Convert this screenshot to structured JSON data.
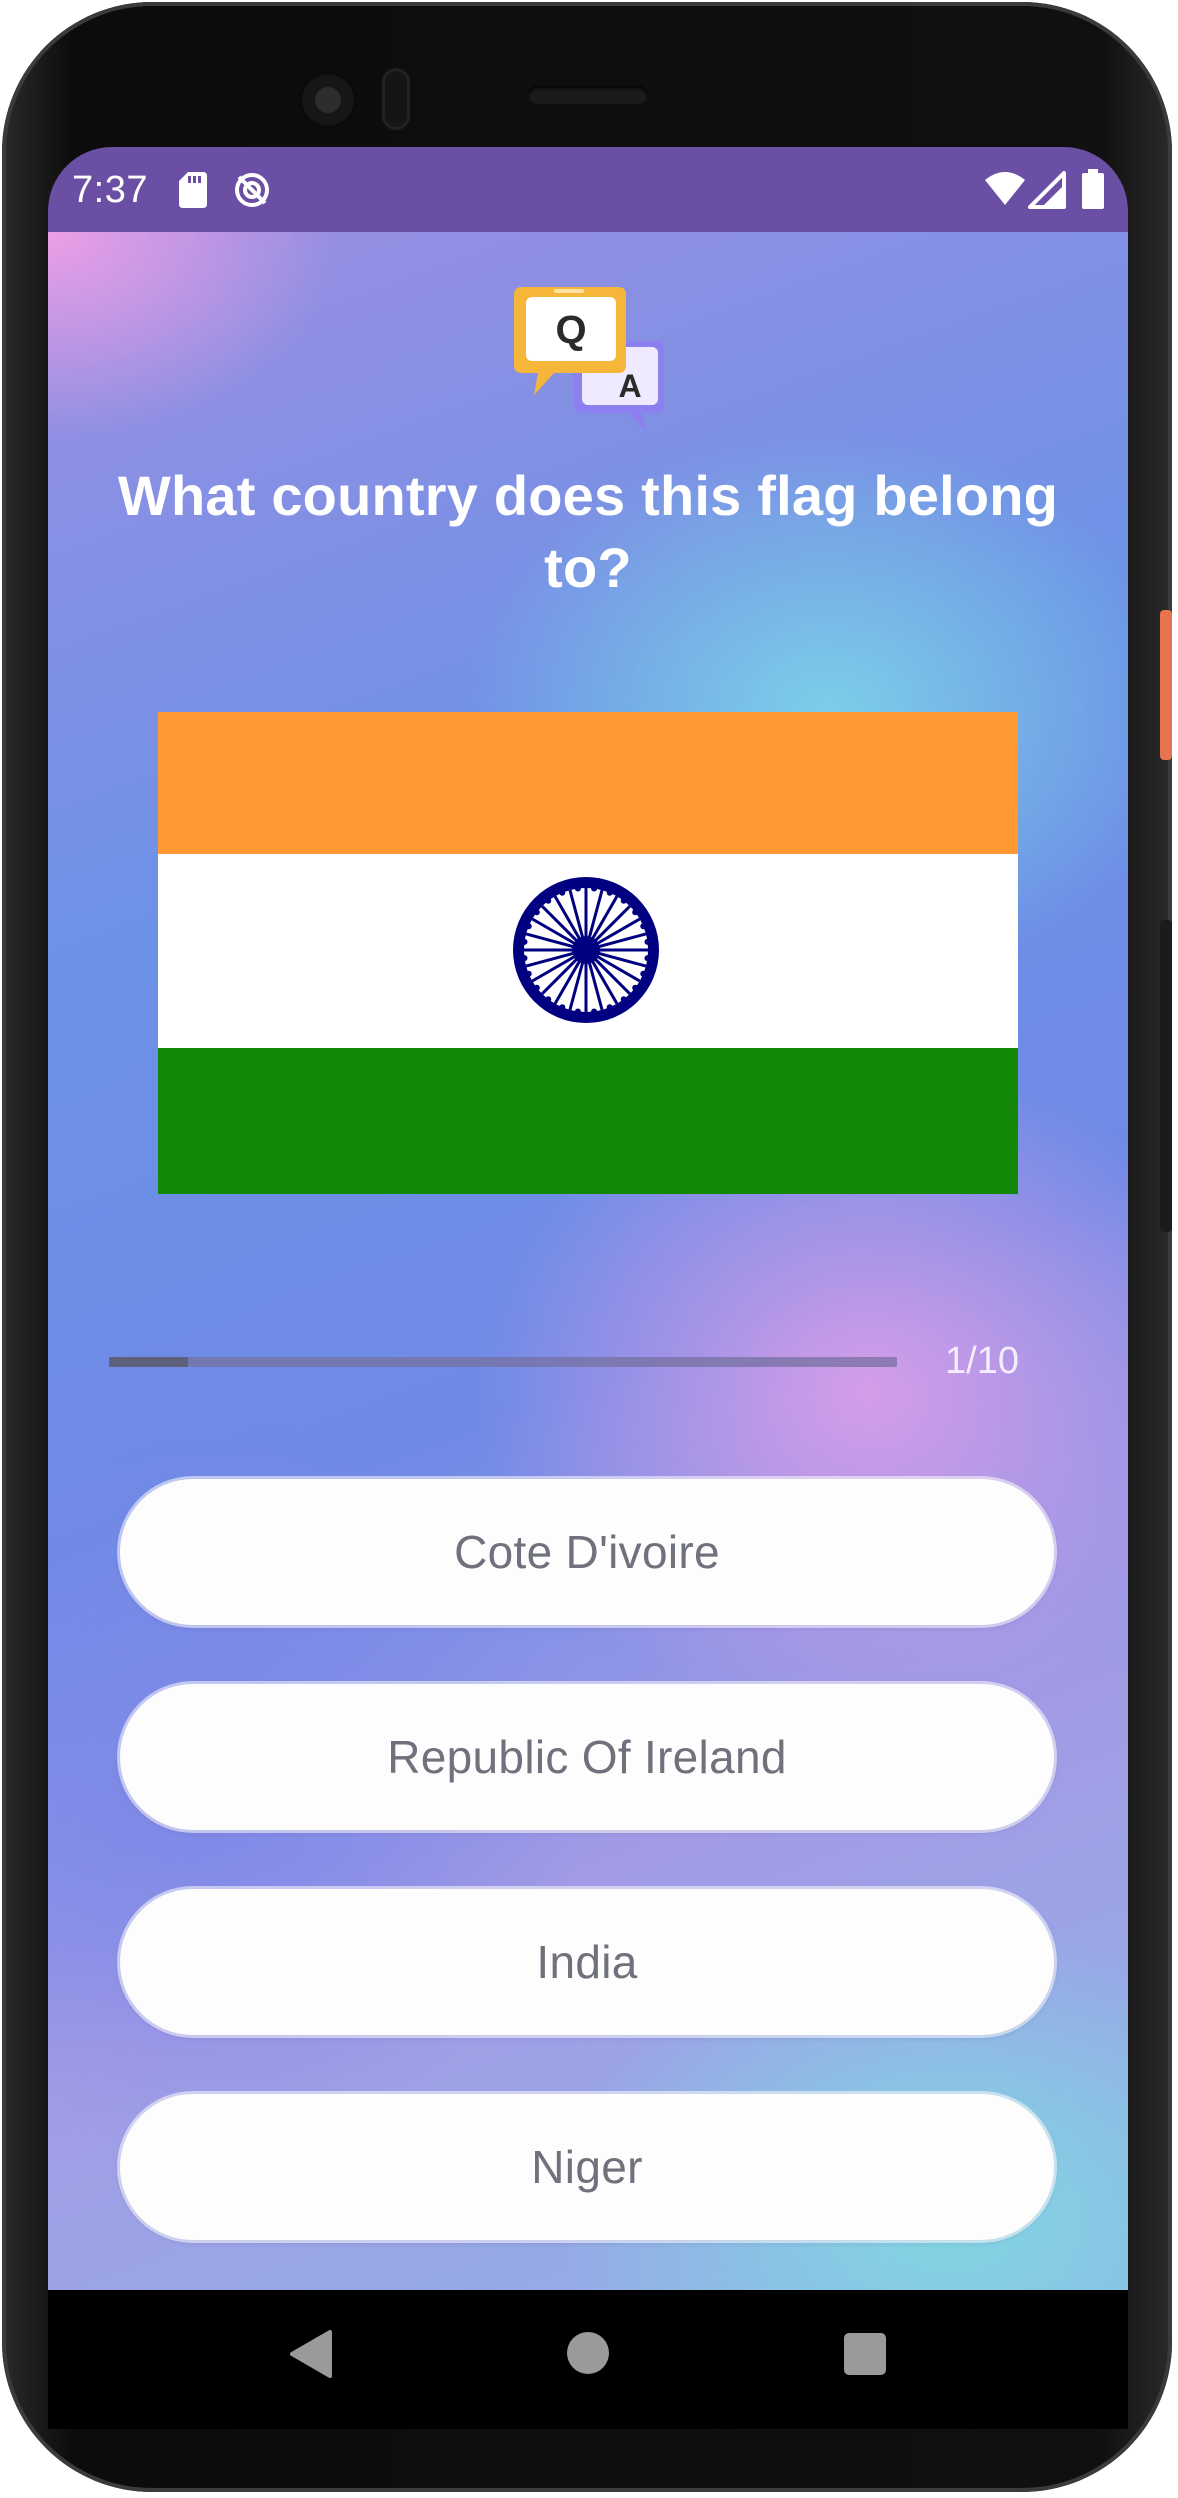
{
  "status_bar": {
    "time": "7:37",
    "icons": [
      "sd-card-icon",
      "sync-disabled-icon",
      "wifi-icon",
      "signal-icon",
      "battery-icon"
    ]
  },
  "quiz": {
    "logo_letters": {
      "question": "Q",
      "answer": "A"
    },
    "question": "What country does this flag belong to?",
    "flag": "India",
    "progress": {
      "current": 1,
      "total": 10,
      "label": "1/10",
      "fraction": 0.1
    },
    "options": [
      "Cote D'ivoire",
      "Republic Of Ireland",
      "India",
      "Niger"
    ]
  },
  "nav_bar": {
    "buttons": [
      "back-icon",
      "home-icon",
      "recents-icon"
    ]
  },
  "colors": {
    "status_bar": "#6b4fa4",
    "flag_saffron": "#FF9933",
    "flag_white": "#FFFFFF",
    "flag_green": "#138808",
    "chakra_navy": "#000080",
    "option_bg": "#fdfdfd",
    "option_text": "#6f717c",
    "logo_yellow": "#f6b63a",
    "logo_purple": "#8c7ff0"
  }
}
